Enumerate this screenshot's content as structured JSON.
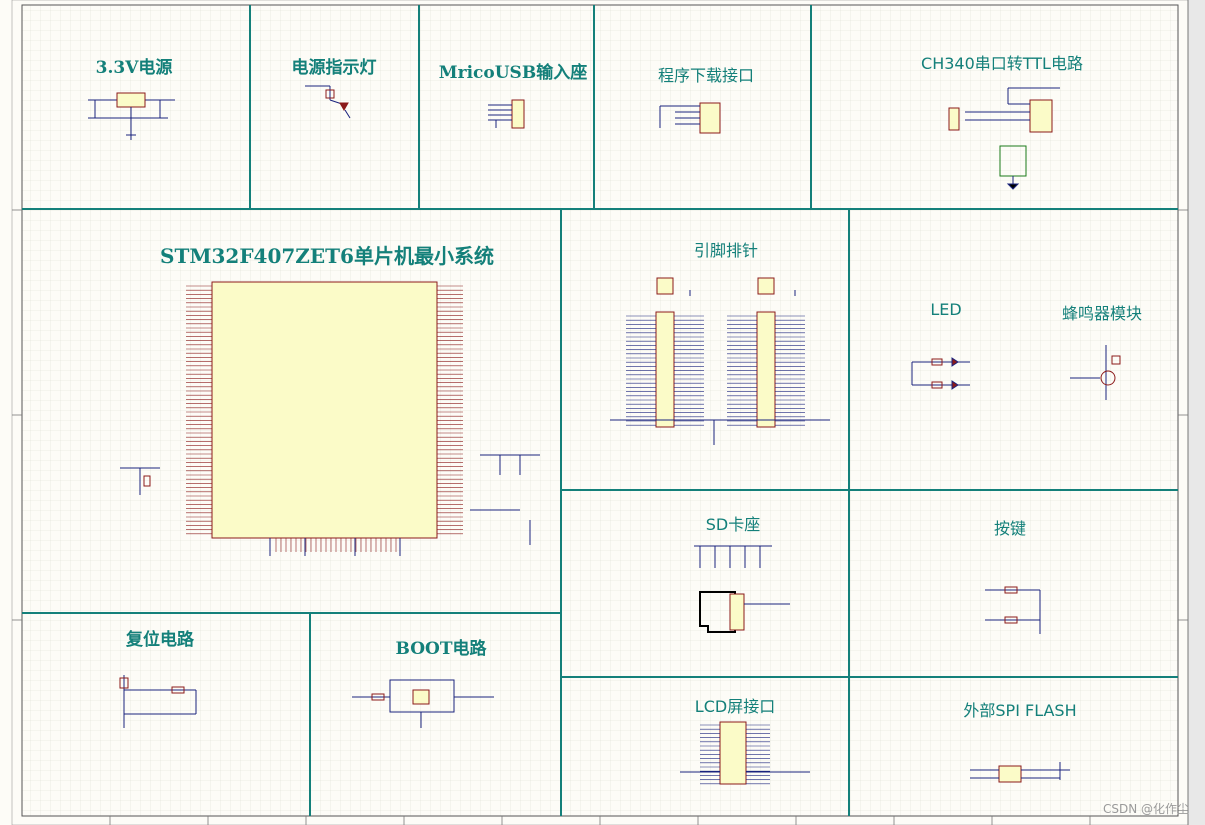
{
  "colors": {
    "background": "#fdfcf7",
    "grid": "#d8d8d0",
    "partition": "#14807a",
    "wire": "#1a237e",
    "component": "#8b1a1a",
    "ic_fill": "#fbfbc8",
    "text": "#14807a"
  },
  "sections": {
    "power_33v": "3.3V电源",
    "power_led": "电源指示灯",
    "micro_usb": "MricoUSB输入座",
    "download": "程序下载接口",
    "ch340": "CH340串口转TTL电路",
    "mcu": "STM32F407ZET6单片机最小系统",
    "pin_header": "引脚排针",
    "led": "LED",
    "buzzer": "蜂鸣器模块",
    "sd_card": "SD卡座",
    "keys": "按键",
    "reset": "复位电路",
    "boot": "BOOT电路",
    "lcd": "LCD屏接口",
    "spi_flash": "外部SPI FLASH"
  },
  "watermark": "CSDN @化作尘"
}
